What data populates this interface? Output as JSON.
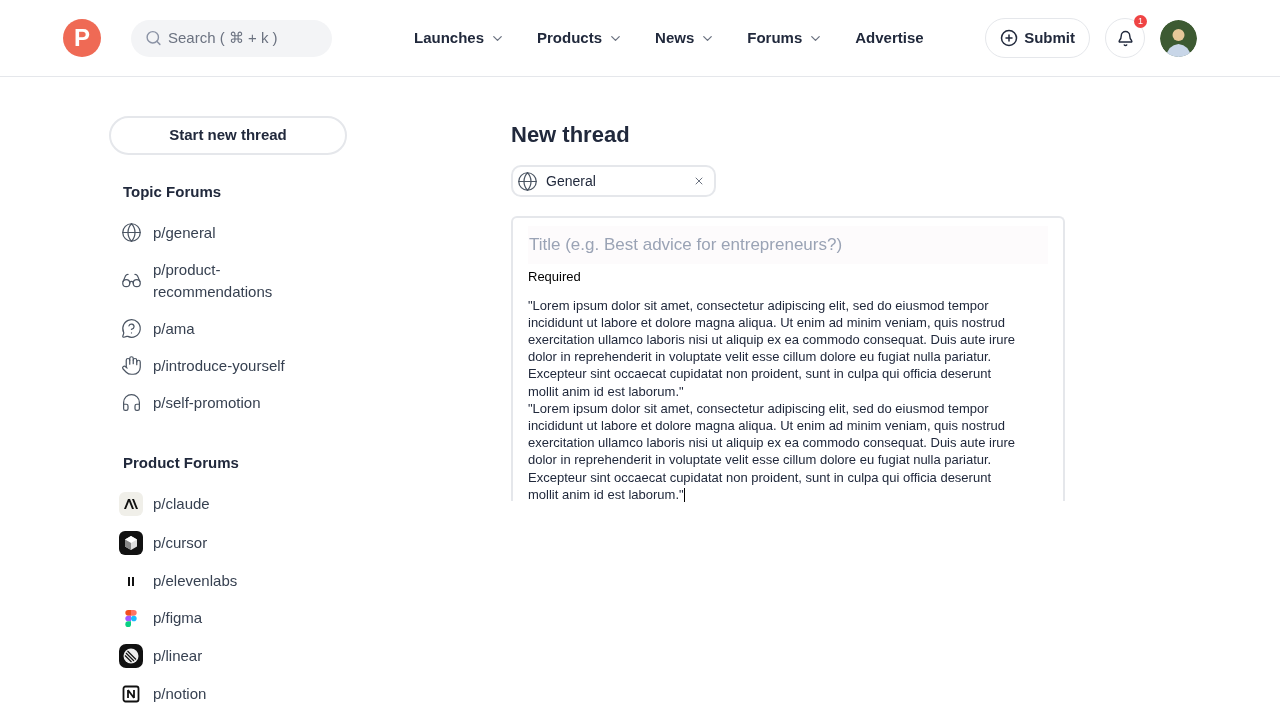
{
  "header": {
    "logo": "P",
    "search": {
      "placeholder": "Search ( ⌘ + k )"
    },
    "nav": [
      {
        "label": "Launches",
        "dropdown": true
      },
      {
        "label": "Products",
        "dropdown": true
      },
      {
        "label": "News",
        "dropdown": true
      },
      {
        "label": "Forums",
        "dropdown": true
      },
      {
        "label": "Advertise",
        "dropdown": false
      }
    ],
    "submit": "Submit",
    "notifications": "1"
  },
  "sidebar": {
    "new_thread": "Start new thread",
    "sections": [
      {
        "title": "Topic Forums",
        "kind": "topic",
        "items": [
          "p/general",
          "p/product-recommendations",
          "p/ama",
          "p/introduce-yourself",
          "p/self-promotion"
        ]
      },
      {
        "title": "Product Forums",
        "kind": "product",
        "items": [
          "p/claude",
          "p/cursor",
          "p/elevenlabs",
          "p/figma",
          "p/linear",
          "p/notion"
        ]
      }
    ]
  },
  "editor": {
    "heading": "New thread",
    "forum_chip": "General",
    "title": {
      "placeholder": "Title (e.g. Best advice for entrepreneurs?)"
    },
    "hint": "Required",
    "body": [
      "\"Lorem ipsum dolor sit amet, consectetur adipiscing elit, sed do eiusmod tempor incididunt ut labore et dolore magna aliqua. Ut enim ad minim veniam, quis nostrud exercitation ullamco laboris nisi ut aliquip ex ea commodo consequat. Duis aute irure dolor in reprehenderit in voluptate velit esse cillum dolore eu fugiat nulla pariatur. Excepteur sint occaecat cupidatat non proident, sunt in culpa qui officia deserunt mollit anim id est laborum.\"",
      "\"Lorem ipsum dolor sit amet, consectetur adipiscing elit, sed do eiusmod tempor incididunt ut labore et dolore magna aliqua. Ut enim ad minim veniam, quis nostrud exercitation ullamco laboris nisi ut aliquip ex ea commodo consequat. Duis aute irure dolor in reprehenderit in voluptate velit esse cillum dolore eu fugiat nulla pariatur. Excepteur sint occaecat cupidatat non proident, sunt in culpa qui officia deserunt mollit anim id est laborum.\""
    ]
  }
}
